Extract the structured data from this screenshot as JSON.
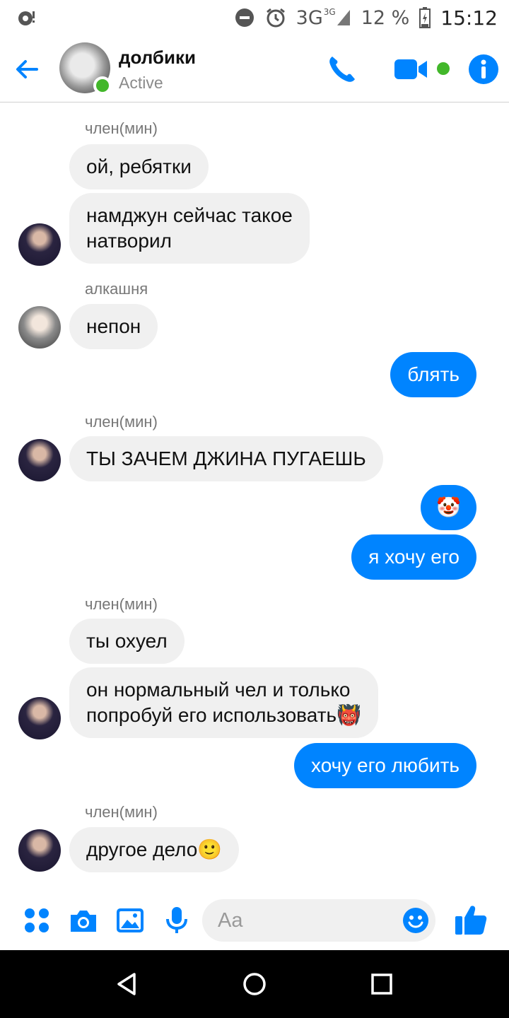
{
  "status_bar": {
    "network": "3G",
    "network_sup": "3G",
    "battery": "12 %",
    "time": "15:12"
  },
  "header": {
    "title": "долбики",
    "status": "Active"
  },
  "messages": [
    {
      "sender": "член(мин)"
    },
    {
      "text": "ой, ребятки"
    },
    {
      "text_line1": "намджун сейчас такое",
      "text_line2": "натворил"
    },
    {
      "sender": "алкашня"
    },
    {
      "text": "непон"
    },
    {
      "text": "блять"
    },
    {
      "sender": "член(мин)"
    },
    {
      "text": "ТЫ ЗАЧЕМ ДЖИНА ПУГАЕШЬ"
    },
    {
      "text": "🤡"
    },
    {
      "text": "я хочу его"
    },
    {
      "sender": "член(мин)"
    },
    {
      "text": "ты охуел"
    },
    {
      "text_line1": "он нормальный чел и только",
      "text_line2": "попробуй его использовать",
      "emoji": "👹"
    },
    {
      "text": "хочу его любить"
    },
    {
      "sender": "член(мин)"
    },
    {
      "text": "другое дело",
      "emoji": "🙂"
    }
  ],
  "composer": {
    "placeholder": "Aa"
  },
  "colors": {
    "accent": "#0084ff",
    "incoming_bubble": "#f0f0f0",
    "online": "#42b72a"
  },
  "icons": [
    "menu-dots-icon",
    "camera-icon",
    "gallery-icon",
    "microphone-icon",
    "emoji-icon",
    "like-icon",
    "phone-icon",
    "video-icon",
    "info-icon",
    "back-arrow-icon"
  ]
}
